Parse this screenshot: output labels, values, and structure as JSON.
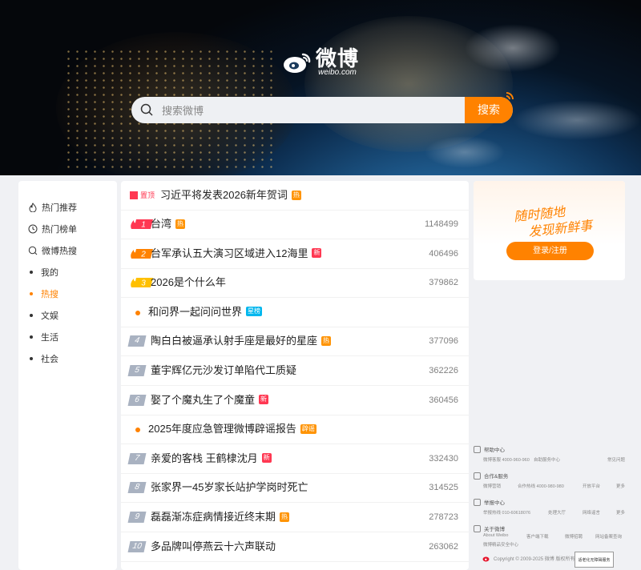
{
  "logo": {
    "main": "微博",
    "sub": "weibo.com"
  },
  "search": {
    "placeholder": "搜索微博",
    "button": "搜索"
  },
  "nav": {
    "main_items": [
      "热门推荐",
      "热门榜单",
      "微博热搜"
    ],
    "sub_items": [
      "我的",
      "热搜",
      "文娱",
      "生活",
      "社会"
    ],
    "active_sub": "热搜"
  },
  "hot": {
    "pinned": {
      "tag": "置顶",
      "title": "习近平将发表2026新年贺词",
      "badge": "热"
    },
    "rows": [
      {
        "rank": "1",
        "title": "台湾",
        "badge": "热",
        "badge_color": "#ff9406",
        "count": "1148499"
      },
      {
        "rank": "2",
        "title": "台军承认五大演习区域进入12海里",
        "badge": "新",
        "badge_color": "#ff3852",
        "count": "406496"
      },
      {
        "rank": "3",
        "title": "2026是个什么年",
        "badge": "",
        "badge_color": "",
        "count": "379862"
      },
      {
        "rank": "",
        "title": "和问界一起问问世界",
        "badge": "星榜",
        "badge_color": "#00b7ee",
        "count": ""
      },
      {
        "rank": "4",
        "title": "陶白白被逼承认射手座是最好的星座",
        "badge": "热",
        "badge_color": "#ff9406",
        "count": "377096"
      },
      {
        "rank": "5",
        "title": "董宇辉亿元沙发订单陷代工质疑",
        "badge": "",
        "badge_color": "",
        "count": "362226"
      },
      {
        "rank": "6",
        "title": "娶了个魔丸生了个魔童",
        "badge": "新",
        "badge_color": "#ff3852",
        "count": "360456"
      },
      {
        "rank": "",
        "title": "2025年度应急管理微博辟谣报告",
        "badge": "辟谣",
        "badge_color": "#ff9406",
        "count": ""
      },
      {
        "rank": "7",
        "title": "亲爱的客栈 王鹤棣沈月",
        "badge": "新",
        "badge_color": "#ff3852",
        "count": "332430"
      },
      {
        "rank": "8",
        "title": "张家界一45岁家长站护学岗时死亡",
        "badge": "",
        "badge_color": "",
        "count": "314525"
      },
      {
        "rank": "9",
        "title": "磊磊渐冻症病情接近终末期",
        "badge": "热",
        "badge_color": "#ff9406",
        "count": "278723"
      },
      {
        "rank": "10",
        "title": "多品牌叫停燕云十六声联动",
        "badge": "",
        "badge_color": "",
        "count": "263062"
      }
    ]
  },
  "promo": {
    "slogan1": "随时随地",
    "slogan2": "发现新鲜事",
    "button": "登录/注册"
  },
  "footer": {
    "sections": [
      {
        "title": "帮助中心",
        "lines": [
          "微博客服 4000-960-960",
          "自助服务中心",
          "常见问题"
        ]
      },
      {
        "title": "合作&服务",
        "lines": [
          "微博营销",
          "合作热线 4000-980-980",
          "开放平台",
          "更多"
        ]
      },
      {
        "title": "举报中心",
        "lines": [
          "举报热线 010-60618076",
          "处理大厅",
          "网络谣言",
          "更多"
        ]
      },
      {
        "title": "关于微博",
        "lines": [
          "About Weibo",
          "客户端下载",
          "微博招聘",
          "网站备案查询",
          "微博精品安全中心"
        ]
      }
    ],
    "copyright": "Copyright © 2009-2025 微博 版权所有",
    "access": "适老化无障碍服务"
  }
}
